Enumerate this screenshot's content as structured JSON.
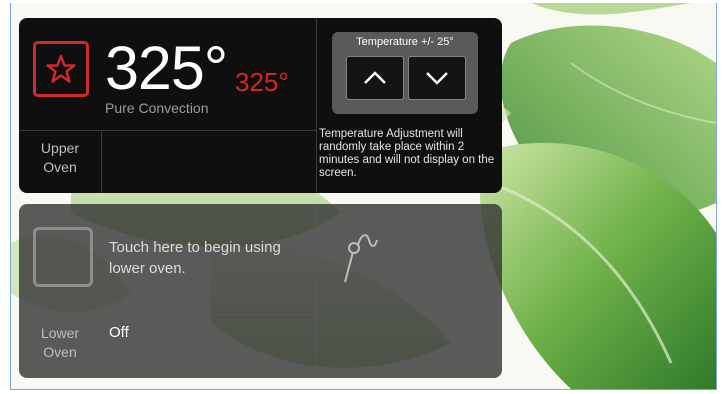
{
  "upper": {
    "current_temp": "325°",
    "set_temp": "325°",
    "mode": "Pure Convection",
    "oven_label_line1": "Upper",
    "oven_label_line2": "Oven",
    "icon": "star-icon"
  },
  "temperature_adjust": {
    "title": "Temperature +/- 25°",
    "up_icon": "chevron-up-icon",
    "down_icon": "chevron-down-icon",
    "note": "Temperature Adjustment will randomly take place within 2 minutes and will not display on the screen."
  },
  "lower": {
    "message": "Touch here to begin using lower oven.",
    "oven_label_line1": "Lower",
    "oven_label_line2": "Oven",
    "status": "Off",
    "icon": "probe-icon"
  },
  "colors": {
    "accent_red": "#d12a2a",
    "panel_dark": "#0f0f0f",
    "panel_gray": "#373737"
  }
}
